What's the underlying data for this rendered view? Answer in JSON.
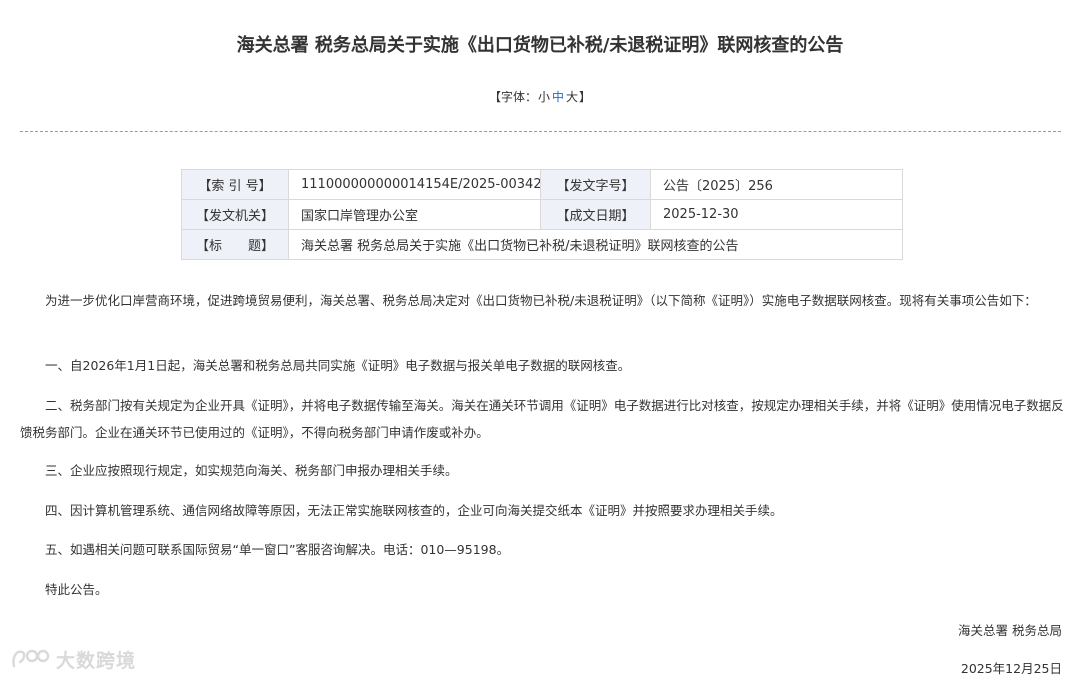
{
  "title": "海关总署 税务总局关于实施《出口货物已补税/未退税证明》联网核查的公告",
  "font_size": {
    "prefix": "【字体：",
    "small": "小",
    "medium": "中",
    "large": "大",
    "suffix": "】"
  },
  "meta": {
    "index_label": "【索 引 号】",
    "index_value": "111000000000014154E/2025-00342",
    "doc_no_label": "【发文字号】",
    "doc_no_value": "公告〔2025〕256",
    "issuer_label": "【发文机关】",
    "issuer_value": "国家口岸管理办公室",
    "date_label": "【成文日期】",
    "date_value": "2025-12-30",
    "title_label": "【标　　题】",
    "title_value": "海关总署 税务总局关于实施《出口货物已补税/未退税证明》联网核查的公告"
  },
  "body": {
    "intro": "为进一步优化口岸营商环境，促进跨境贸易便利，海关总署、税务总局决定对《出口货物已补税/未退税证明》（以下简称《证明》）实施电子数据联网核查。现将有关事项公告如下：",
    "item1": "一、自2026年1月1日起，海关总署和税务总局共同实施《证明》电子数据与报关单电子数据的联网核查。",
    "item2": "二、税务部门按有关规定为企业开具《证明》，并将电子数据传输至海关。海关在通关环节调用《证明》电子数据进行比对核查，按规定办理相关手续，并将《证明》使用情况电子数据反馈税务部门。企业在通关环节已使用过的《证明》，不得向税务部门申请作废或补办。",
    "item3": "三、企业应按照现行规定，如实规范向海关、税务部门申报办理相关手续。",
    "item4": "四、因计算机管理系统、通信网络故障等原因，无法正常实施联网核查的，企业可向海关提交纸本《证明》并按照要求办理相关手续。",
    "item5": "五、如遇相关问题可联系国际贸易“单一窗口”客服咨询解决。电话：010—95198。",
    "closing": "特此公告。"
  },
  "signature": {
    "issuer": "海关总署 税务总局",
    "date": "2025年12月25日"
  },
  "watermark": {
    "text": "大数跨境"
  }
}
